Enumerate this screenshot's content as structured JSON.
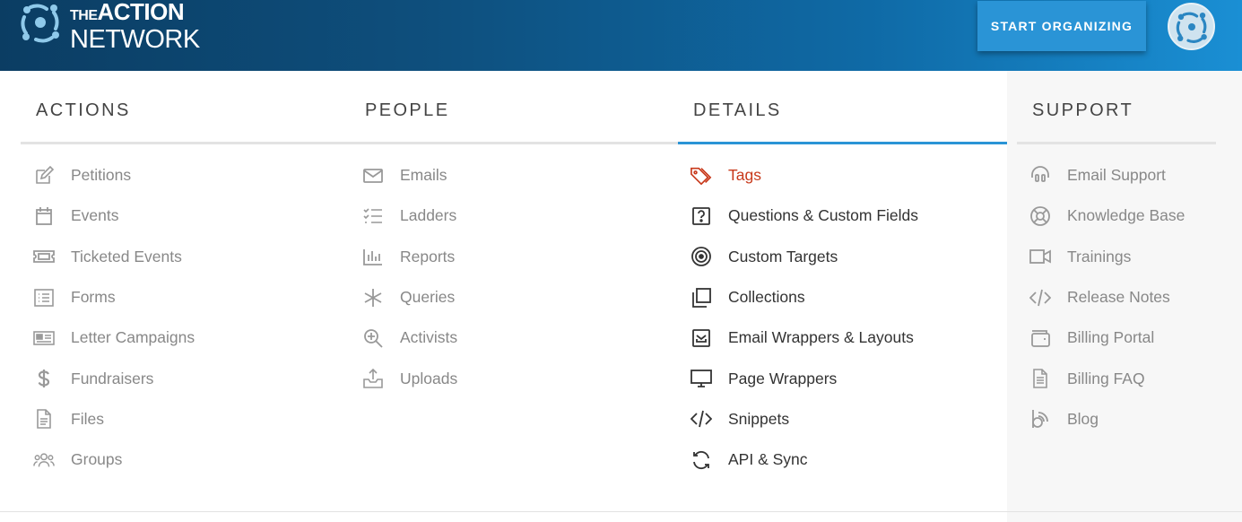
{
  "header": {
    "logo_small": "THE",
    "logo_line1": "ACTION",
    "logo_line2": "NETWORK",
    "cta_label": "START ORGANIZING"
  },
  "colors": {
    "header_start": "#0b3d63",
    "header_end": "#1a8fd4",
    "button": "#2a94d6",
    "active_underline": "#2a94d6",
    "active_item": "#c8391b"
  },
  "columns": [
    {
      "title": "ACTIONS",
      "items": [
        {
          "label": "Petitions",
          "icon": "edit-icon"
        },
        {
          "label": "Events",
          "icon": "calendar-icon"
        },
        {
          "label": "Ticketed Events",
          "icon": "ticket-icon"
        },
        {
          "label": "Forms",
          "icon": "form-list-icon"
        },
        {
          "label": "Letter Campaigns",
          "icon": "newspaper-icon"
        },
        {
          "label": "Fundraisers",
          "icon": "dollar-icon"
        },
        {
          "label": "Files",
          "icon": "file-icon"
        },
        {
          "label": "Groups",
          "icon": "users-icon"
        }
      ]
    },
    {
      "title": "PEOPLE",
      "items": [
        {
          "label": "Emails",
          "icon": "envelope-icon"
        },
        {
          "label": "Ladders",
          "icon": "checklist-icon"
        },
        {
          "label": "Reports",
          "icon": "bar-chart-icon"
        },
        {
          "label": "Queries",
          "icon": "asterisk-icon"
        },
        {
          "label": "Activists",
          "icon": "zoom-plus-icon"
        },
        {
          "label": "Uploads",
          "icon": "upload-icon"
        }
      ]
    },
    {
      "title": "DETAILS",
      "active": true,
      "items": [
        {
          "label": "Tags",
          "icon": "tags-icon",
          "active": true
        },
        {
          "label": "Questions & Custom Fields",
          "icon": "question-box-icon"
        },
        {
          "label": "Custom Targets",
          "icon": "target-icon"
        },
        {
          "label": "Collections",
          "icon": "copy-icon"
        },
        {
          "label": "Email Wrappers & Layouts",
          "icon": "envelope-box-icon"
        },
        {
          "label": "Page Wrappers",
          "icon": "monitor-icon"
        },
        {
          "label": "Snippets",
          "icon": "code-icon"
        },
        {
          "label": "API & Sync",
          "icon": "sync-icon"
        }
      ]
    },
    {
      "title": "SUPPORT",
      "items": [
        {
          "label": "Email Support",
          "icon": "headset-icon"
        },
        {
          "label": "Knowledge Base",
          "icon": "life-ring-icon"
        },
        {
          "label": "Trainings",
          "icon": "video-icon"
        },
        {
          "label": "Release Notes",
          "icon": "code-icon"
        },
        {
          "label": "Billing Portal",
          "icon": "wallet-icon"
        },
        {
          "label": "Billing FAQ",
          "icon": "document-icon"
        },
        {
          "label": "Blog",
          "icon": "blog-icon"
        }
      ]
    }
  ]
}
